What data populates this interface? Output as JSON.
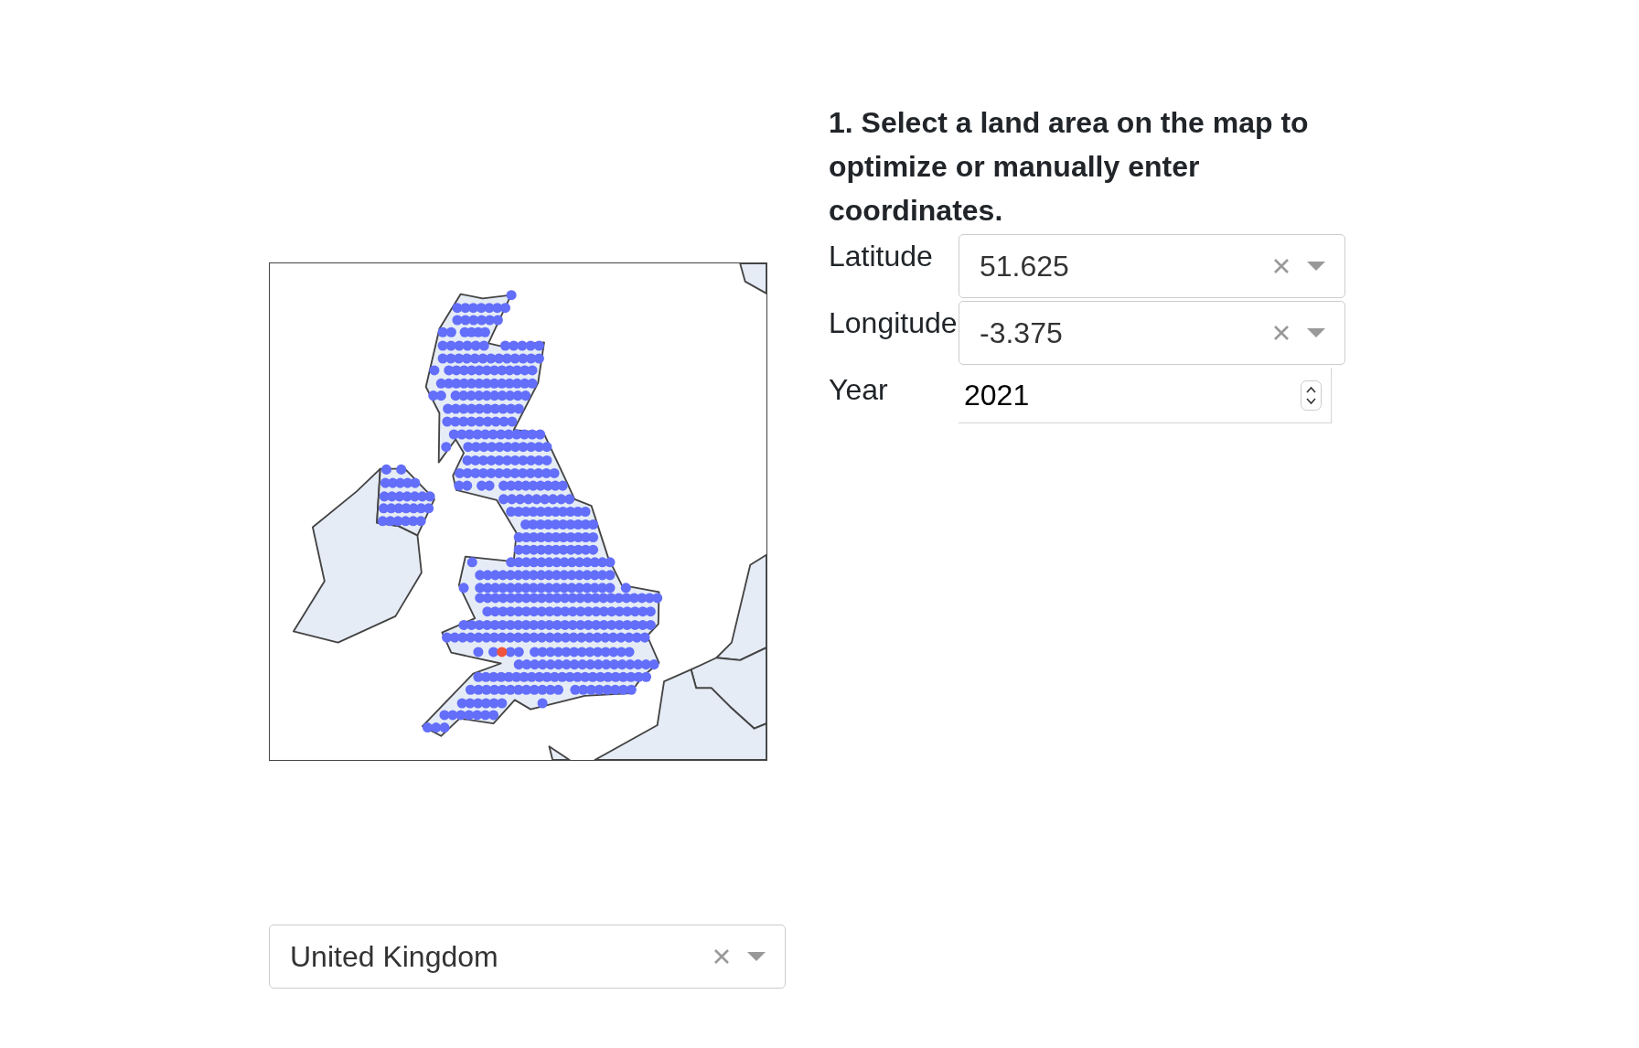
{
  "heading": "1. Select a land area on the map to optimize or manually enter coordinates.",
  "fields": [
    {
      "kind": "select",
      "label": "Latitude",
      "value": "51.625"
    },
    {
      "kind": "select",
      "label": "Longitude",
      "value": "-3.375"
    },
    {
      "kind": "number",
      "label": "Year",
      "value": "2021"
    }
  ],
  "country_select": {
    "value": "United Kingdom"
  }
}
